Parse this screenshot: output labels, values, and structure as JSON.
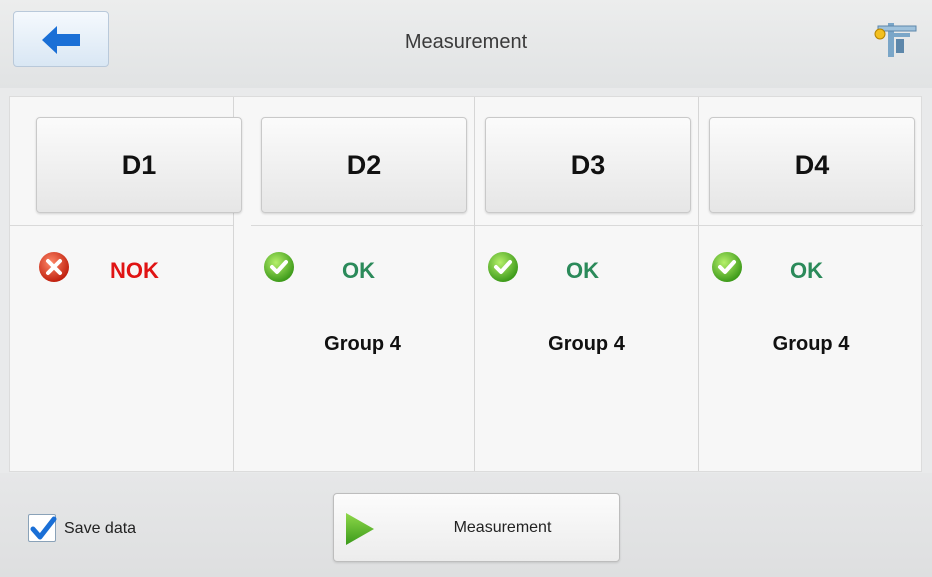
{
  "header": {
    "title": "Measurement"
  },
  "columns": [
    {
      "label": "D1",
      "status": "NOK",
      "state": "nok",
      "group": ""
    },
    {
      "label": "D2",
      "status": "OK",
      "state": "ok",
      "group": "Group 4"
    },
    {
      "label": "D3",
      "status": "OK",
      "state": "ok",
      "group": "Group 4"
    },
    {
      "label": "D4",
      "status": "OK",
      "state": "ok",
      "group": "Group 4"
    }
  ],
  "footer": {
    "save_data_label": "Save data",
    "save_data_checked": true,
    "measurement_button_label": "Measurement"
  },
  "colors": {
    "ok": "#2b8a5a",
    "nok": "#e01414",
    "accent": "#1a6fd6"
  },
  "icons": {
    "back": "arrow-left-icon",
    "tool": "caliper-icon",
    "ok": "check-circle-icon",
    "nok": "x-circle-icon",
    "play": "play-icon"
  }
}
